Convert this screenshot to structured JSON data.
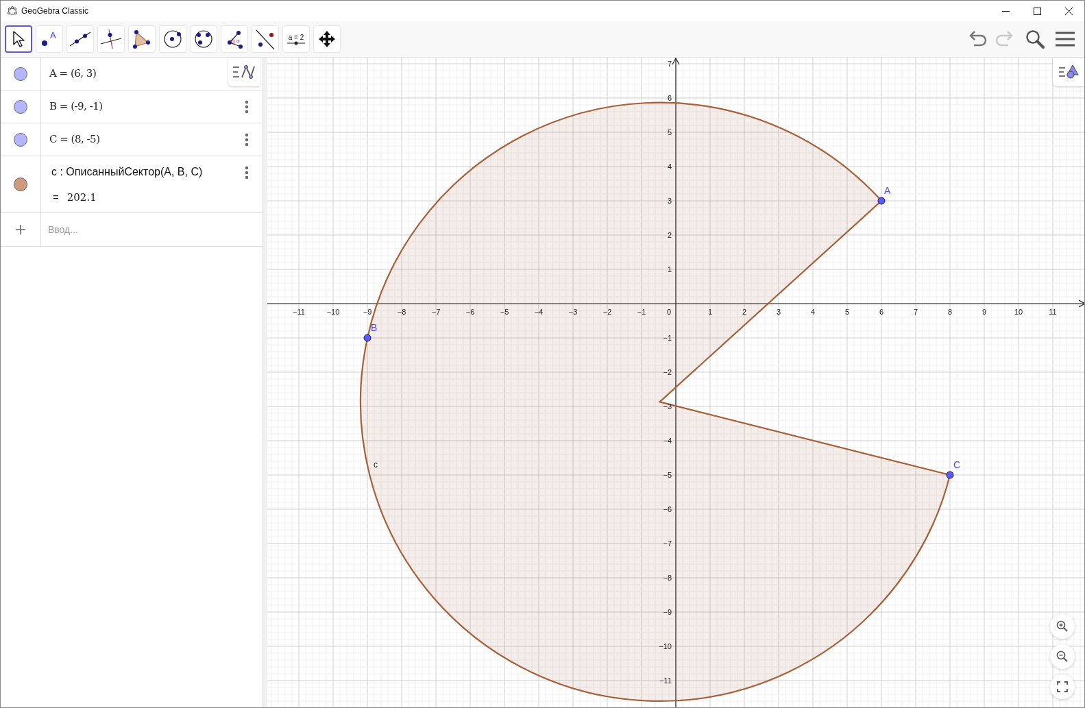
{
  "window": {
    "title": "GeoGebra Classic"
  },
  "toolbar": {
    "tools": [
      {
        "kind": "move",
        "selected": true
      },
      {
        "kind": "point",
        "selected": false,
        "glyph": "A"
      },
      {
        "kind": "line",
        "selected": false
      },
      {
        "kind": "perpendicular",
        "selected": false
      },
      {
        "kind": "polygon",
        "selected": false
      },
      {
        "kind": "circle",
        "selected": false
      },
      {
        "kind": "circle3",
        "selected": false
      },
      {
        "kind": "angle",
        "selected": false,
        "glyph": "α"
      },
      {
        "kind": "reflect",
        "selected": false
      },
      {
        "kind": "slider",
        "selected": false,
        "label": "a = 2"
      },
      {
        "kind": "pan",
        "selected": false
      }
    ]
  },
  "algebra": {
    "items": [
      {
        "kind": "point",
        "definition": "A = (6, 3)",
        "color": "#b4b4ff"
      },
      {
        "kind": "point",
        "definition": "B = (-9, -1)",
        "color": "#b4b4ff"
      },
      {
        "kind": "point",
        "definition": "C = (8, -5)",
        "color": "#b4b4ff"
      },
      {
        "kind": "sector",
        "definition": "c : ОписанныйСектор(A, B, C)",
        "equals": "=",
        "value": "202.1",
        "color": "#d09a80"
      }
    ],
    "input": {
      "placeholder": "Ввод..."
    }
  },
  "graphics": {
    "x_ticks": [
      "−11",
      "−10",
      "−9",
      "−8",
      "−7",
      "−6",
      "−5",
      "−4",
      "−3",
      "−2",
      "−1",
      "0",
      "1",
      "2",
      "3",
      "4",
      "5",
      "6",
      "7",
      "8",
      "9",
      "10",
      "11"
    ],
    "y_ticks_positive": [
      "7",
      "6",
      "5",
      "4",
      "3",
      "2",
      "1"
    ],
    "y_ticks_negative": [
      "−1",
      "−2",
      "−3",
      "−4",
      "−5",
      "−6",
      "−7",
      "−8",
      "−9",
      "−10",
      "−11"
    ],
    "points": [
      {
        "label": "A"
      },
      {
        "label": "B"
      },
      {
        "label": "C"
      }
    ],
    "sector_label": "c"
  }
}
